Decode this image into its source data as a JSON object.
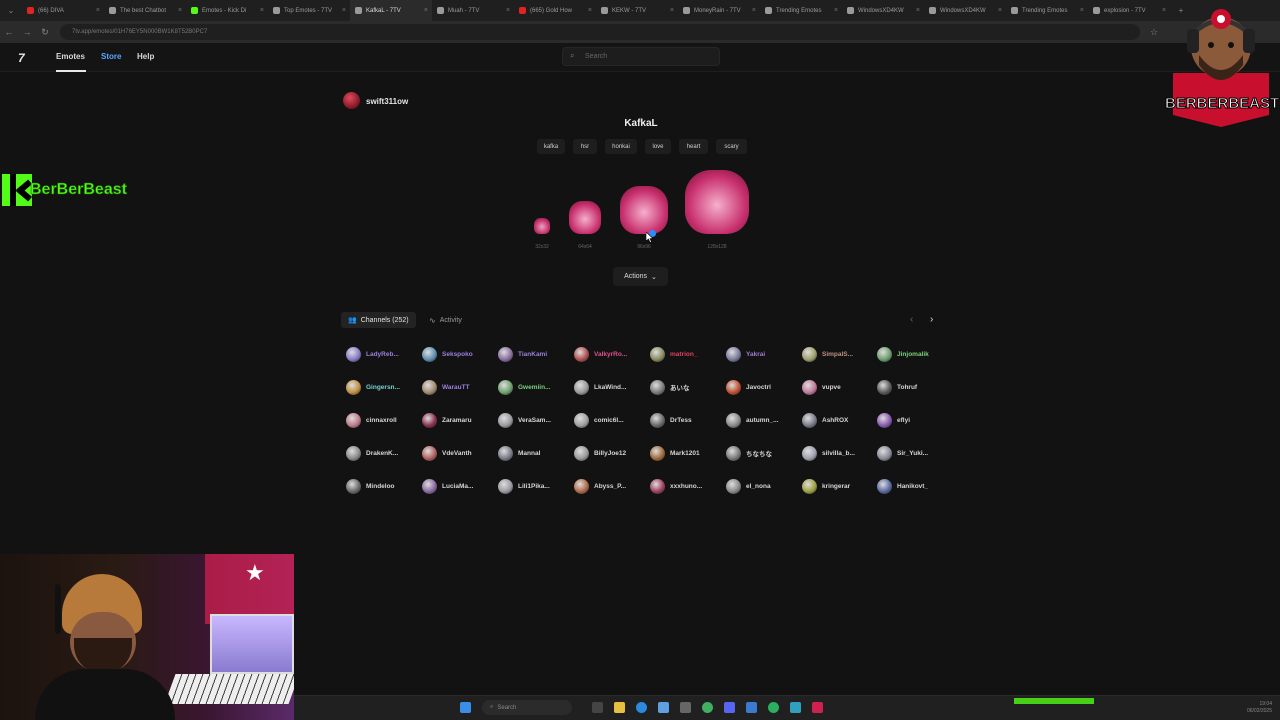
{
  "browser": {
    "tabs": [
      {
        "title": "(66) DIVA",
        "color": "#e02424"
      },
      {
        "title": "The best Chatbot",
        "color": "#9a9a9a"
      },
      {
        "title": "Emotes - Kick Di",
        "color": "#53fc18"
      },
      {
        "title": "Top Emotes - 7TV",
        "color": "#9a9a9a"
      },
      {
        "title": "KafkaL - 7TV",
        "color": "#9a9a9a"
      },
      {
        "title": "Muah - 7TV",
        "color": "#9a9a9a"
      },
      {
        "title": "(665) Gold How",
        "color": "#e02424"
      },
      {
        "title": "KEKW - 7TV",
        "color": "#9a9a9a"
      },
      {
        "title": "MoneyRain - 7TV",
        "color": "#9a9a9a"
      },
      {
        "title": "Trending Emotes",
        "color": "#9a9a9a"
      },
      {
        "title": "WindowsXD4KW",
        "color": "#9a9a9a"
      },
      {
        "title": "WindowsXD4KW",
        "color": "#9a9a9a"
      },
      {
        "title": "Trending Emotes",
        "color": "#9a9a9a"
      },
      {
        "title": "explosion - 7TV",
        "color": "#9a9a9a"
      }
    ],
    "url": "7tv.app/emotes/01H76EY5N000BW1K8T52B0PC7"
  },
  "site": {
    "logo": "7",
    "nav": {
      "emotes": "Emotes",
      "store": "Store",
      "help": "Help"
    },
    "search_placeholder": "Search"
  },
  "overlay": {
    "channel_logo": "BERBERBEAST",
    "tv_logo": "BerBerBeast"
  },
  "emote": {
    "owner": "swift311ow",
    "name": "KafkaL",
    "tags": [
      "kafka",
      "hsr",
      "honkai",
      "love",
      "heart",
      "scary"
    ],
    "sizes": [
      "32x32",
      "64x64",
      "96x96",
      "128x128"
    ],
    "actions_label": "Actions"
  },
  "tabs": {
    "channels_label": "Channels (252)",
    "activity_label": "Activity"
  },
  "channels": [
    {
      "name": "LadyReb...",
      "color": "#8a7cc9",
      "text_color": "#9b7fe0"
    },
    {
      "name": "Sekspoko",
      "color": "#5f8fb0",
      "text_color": "#9b7fe0"
    },
    {
      "name": "TianKami",
      "color": "#8a6fa0",
      "text_color": "#9b7fe0"
    },
    {
      "name": "ValkyrRo...",
      "color": "#b05050",
      "text_color": "#e05090"
    },
    {
      "name": "matrion_",
      "color": "#8a8a5f",
      "text_color": "#e04060"
    },
    {
      "name": "Yakrai",
      "color": "#7a7a9f",
      "text_color": "#a07ad0"
    },
    {
      "name": "SimpalS...",
      "color": "#9f9f6f",
      "text_color": "#c09080"
    },
    {
      "name": "Jinjomalik",
      "color": "#6f9f6f",
      "text_color": "#7ad07a"
    },
    {
      "name": "Gingersn...",
      "color": "#c09040",
      "text_color": "#7ad0d0"
    },
    {
      "name": "WarauTT",
      "color": "#a08a6f",
      "text_color": "#9b7fe0"
    },
    {
      "name": "Gwemiin...",
      "color": "#6fa06f",
      "text_color": "#7ad07a"
    },
    {
      "name": "LkaWind...",
      "color": "#9a9a9a",
      "text_color": "#d6d6d6"
    },
    {
      "name": "あいな",
      "color": "#7a7a7a",
      "text_color": "#d6d6d6"
    },
    {
      "name": "Javoctrl",
      "color": "#c05030",
      "text_color": "#d6d6d6"
    },
    {
      "name": "vupve",
      "color": "#c07a9a",
      "text_color": "#d6d6d6"
    },
    {
      "name": "Tohruf",
      "color": "#5a5a5a",
      "text_color": "#d6d6d6"
    },
    {
      "name": "cinnaxroll",
      "color": "#c07a8a",
      "text_color": "#d6d6d6"
    },
    {
      "name": "Zaramaru",
      "color": "#8a3050",
      "text_color": "#d6d6d6"
    },
    {
      "name": "VeraSam...",
      "color": "#9a9aa0",
      "text_color": "#d6d6d6"
    },
    {
      "name": "comic6l...",
      "color": "#a0a0a0",
      "text_color": "#d6d6d6"
    },
    {
      "name": "DrTess",
      "color": "#6a6a6a",
      "text_color": "#d6d6d6"
    },
    {
      "name": "autumn_...",
      "color": "#8a8a8a",
      "text_color": "#d6d6d6"
    },
    {
      "name": "AshROX",
      "color": "#7a7a8a",
      "text_color": "#d6d6d6"
    },
    {
      "name": "eflyi",
      "color": "#8a5ab0",
      "text_color": "#d6d6d6"
    },
    {
      "name": "DrakenK...",
      "color": "#8a8a8a",
      "text_color": "#d6d6d6"
    },
    {
      "name": "VdeVanth",
      "color": "#b06060",
      "text_color": "#d6d6d6"
    },
    {
      "name": "Mannal",
      "color": "#7a7a8a",
      "text_color": "#d6d6d6"
    },
    {
      "name": "BillyJoe12",
      "color": "#9a9a9a",
      "text_color": "#d6d6d6"
    },
    {
      "name": "Mark1201",
      "color": "#a06a3a",
      "text_color": "#d6d6d6"
    },
    {
      "name": "ちなちな",
      "color": "#7a7a7a",
      "text_color": "#d6d6d6"
    },
    {
      "name": "silvilla_b...",
      "color": "#a0a0b0",
      "text_color": "#d6d6d6"
    },
    {
      "name": "Sir_Yuki...",
      "color": "#8a8a9a",
      "text_color": "#d6d6d6"
    },
    {
      "name": "Mindeloo",
      "color": "#6a6a6a",
      "text_color": "#d6d6d6"
    },
    {
      "name": "LuciaMa...",
      "color": "#8a6aa0",
      "text_color": "#d6d6d6"
    },
    {
      "name": "Lili1Pika...",
      "color": "#9a9aa0",
      "text_color": "#d6d6d6"
    },
    {
      "name": "Abyss_P...",
      "color": "#b06a4a",
      "text_color": "#d6d6d6"
    },
    {
      "name": "xxxhuno...",
      "color": "#a04060",
      "text_color": "#d6d6d6"
    },
    {
      "name": "el_nona",
      "color": "#8a8a8a",
      "text_color": "#d6d6d6"
    },
    {
      "name": "kringerar",
      "color": "#a0a040",
      "text_color": "#d6d6d6"
    },
    {
      "name": "Hanikovt_",
      "color": "#5a6aa0",
      "text_color": "#d6d6d6"
    }
  ],
  "taskbar": {
    "search_placeholder": "Search",
    "time": "19:04",
    "date": "06/02/2025"
  }
}
